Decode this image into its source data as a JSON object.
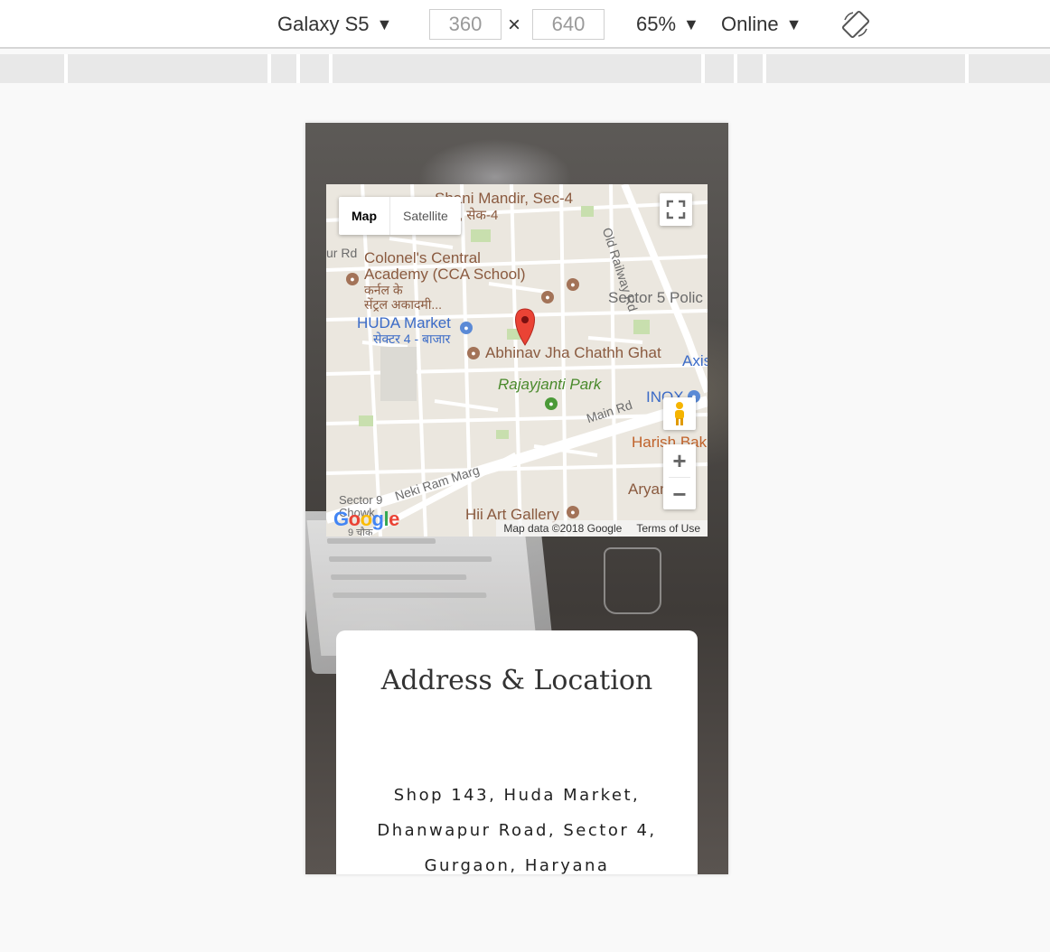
{
  "toolbar": {
    "device": "Galaxy S5",
    "width": "360",
    "height": "640",
    "times": "×",
    "zoom": "65%",
    "network": "Online",
    "caret": "▼",
    "rotate_icon": "rotate-device-icon"
  },
  "map": {
    "type_map": "Map",
    "type_satellite": "Satellite",
    "zoom_in": "+",
    "zoom_out": "−",
    "labels": {
      "shani_mandir": "Shani Mandir, Sec-4",
      "shani_hindi": "मंदिर, सेक-4",
      "old_railway": "Old Railway Rd",
      "ur_rd": "ur Rd",
      "colonels1": "Colonel's Central",
      "colonels2": "Academy (CCA School)",
      "colonels3": "कर्नल के",
      "colonels4": "सेंट्रल अकादमी...",
      "sector5": "Sector 5 Polic",
      "huda": "HUDA Market",
      "huda_hindi": "सेक्टर 4 - बाजार",
      "abhinav": "Abhinav Jha Chathh Ghat",
      "axis": "Axis",
      "rajayjanti": "Rajayjanti Park",
      "inox": "INOX",
      "main_rd": "Main Rd",
      "harish": "Harish Bak",
      "neki": "Neki Ram Marg",
      "aryan": "Aryan",
      "sector9": "Sector 9",
      "chowk": "Chowk",
      "chowk_hindi": "9 चौक",
      "hii_art": "Hii Art Gallery",
      "google": "Google",
      "map_data": "Map data ©2018 Google",
      "terms": "Terms of Use"
    }
  },
  "card": {
    "title": "Address & Location",
    "address_lines": [
      "Shop 143, Huda Market,",
      "Dhanwapur Road, Sector 4,",
      "Gurgaon, Haryana"
    ]
  }
}
